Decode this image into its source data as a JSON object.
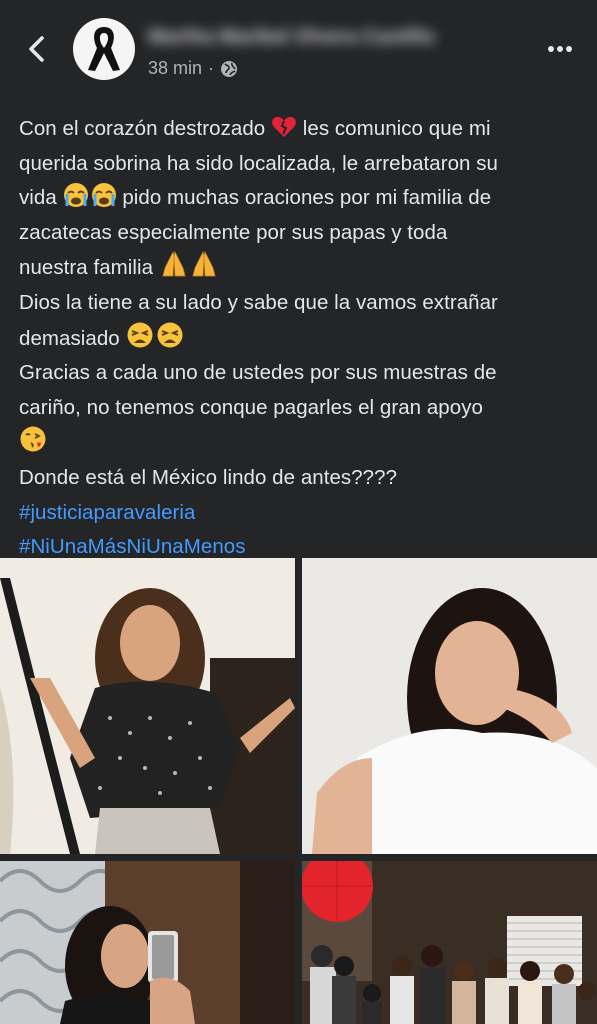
{
  "post": {
    "author_name": "Martha Maribel Olvera Castillo",
    "time": "38 min",
    "separator": "·",
    "lines": {
      "l1a": "Con el corazón destrozado",
      "l1b": "les comunico que mi",
      "l2": "querida sobrina ha sido localizada, le arrebataron su",
      "l3a": "vida",
      "l3b": "pido muchas oraciones por mi familia de",
      "l4": "zacatecas especialmente por sus papas y toda",
      "l5": "nuestra familia",
      "l6": "Dios la tiene a su lado y sabe que la vamos extrañar",
      "l7": "demasiado",
      "l8": "Gracias a cada uno de ustedes por sus muestras de",
      "l9": "cariño, no tenemos conque pagarles  el gran apoyo",
      "l11": "Donde está el México lindo de antes????"
    },
    "hashtags": [
      "#justiciaparavaleria",
      "#NiUnaMásNiUnaMenos"
    ]
  },
  "icons": {
    "back": "chevron-left-icon",
    "more": "more-horizontal-icon",
    "privacy": "globe-icon",
    "emojis": [
      "broken-heart",
      "loudly-crying-face",
      "folded-hands",
      "weary-face",
      "face-blowing-kiss"
    ]
  },
  "colors": {
    "background": "#242526",
    "text": "#e4e6eb",
    "link": "#4599ff",
    "secondary": "#b0b3b8"
  }
}
